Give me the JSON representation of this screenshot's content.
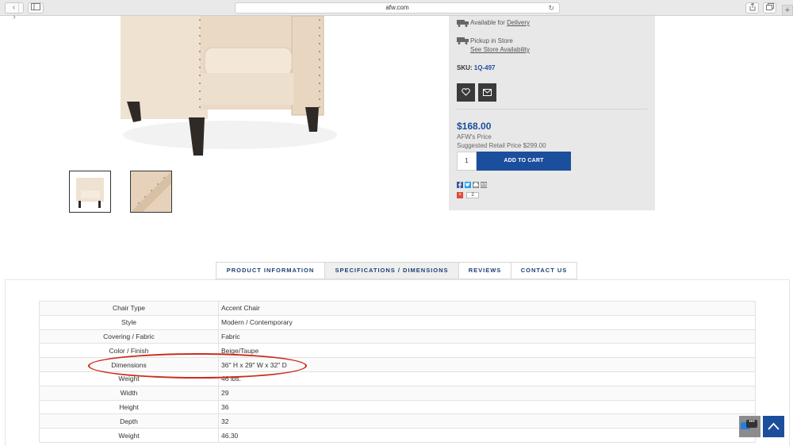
{
  "browser": {
    "url": "afw.com",
    "nav_back": "‹",
    "nav_forward": "›",
    "reload": "↻",
    "new_tab": "+"
  },
  "panel": {
    "delivery_prefix": "Available for ",
    "delivery_link": "Delivery",
    "pickup": "Pickup in Store",
    "store_link": "See Store Availability",
    "sku_label": "SKU: ",
    "sku": "1Q-497",
    "price": "$168.00",
    "price_label": "AFW's Price",
    "retail_label": "Suggested Retail Price ",
    "retail_price": "$299.00",
    "qty": "1",
    "add_to_cart": "ADD TO CART",
    "gplus_count": "2",
    "gplus_label": "+"
  },
  "tabs": [
    {
      "label": "PRODUCT INFORMATION"
    },
    {
      "label": "SPECIFICATIONS / DIMENSIONS"
    },
    {
      "label": "REVIEWS"
    },
    {
      "label": "CONTACT US"
    }
  ],
  "specs": [
    {
      "key": "Chair Type",
      "value": "Accent Chair"
    },
    {
      "key": "Style",
      "value": "Modern / Contemporary"
    },
    {
      "key": "Covering / Fabric",
      "value": "Fabric"
    },
    {
      "key": "Color / Finish",
      "value": "Beige/Taupe"
    },
    {
      "key": "Dimensions",
      "value": "36\" H x 29\" W x 32\" D"
    },
    {
      "key": "Weight",
      "value": "46 lbs."
    },
    {
      "key": "Width",
      "value": "29"
    },
    {
      "key": "Height",
      "value": "36"
    },
    {
      "key": "Depth",
      "value": "32"
    },
    {
      "key": "Weight",
      "value": "46.30"
    }
  ],
  "chat_dots": "•••",
  "colors": {
    "brand_blue": "#1c4e9e",
    "panel_bg": "#e8e8e8",
    "annotation": "#cc2b1d",
    "fabric": "#f0e3d3",
    "legs": "#2f2a26"
  }
}
